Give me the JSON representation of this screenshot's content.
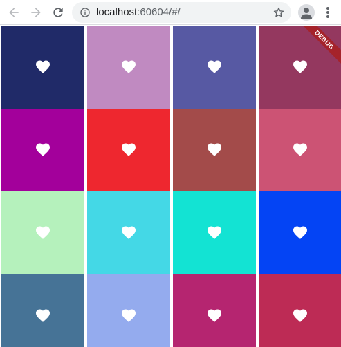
{
  "browser": {
    "url_host": "localhost",
    "url_port_path": ":60604/#/",
    "icons": {
      "back": "arrow-left-icon",
      "forward": "arrow-right-icon",
      "reload": "reload-icon",
      "info": "info-icon",
      "bookmark": "star-icon",
      "profile": "person-icon",
      "menu": "kebab-menu-icon"
    }
  },
  "debug_banner": {
    "label": "DEBUG",
    "color": "#a5232b"
  },
  "tile_icon": "heart-icon",
  "tiles": [
    {
      "color": "#202a68"
    },
    {
      "color": "#c08ac1"
    },
    {
      "color": "#5759a3"
    },
    {
      "color": "#94385f"
    },
    {
      "color": "#a3009b"
    },
    {
      "color": "#ee272f"
    },
    {
      "color": "#a34b4a"
    },
    {
      "color": "#cc5374"
    },
    {
      "color": "#b5f1bc"
    },
    {
      "color": "#44d8e6"
    },
    {
      "color": "#13e3d3"
    },
    {
      "color": "#0444f4"
    },
    {
      "color": "#467396"
    },
    {
      "color": "#94abee"
    },
    {
      "color": "#b52570"
    },
    {
      "color": "#bd2b55"
    }
  ]
}
